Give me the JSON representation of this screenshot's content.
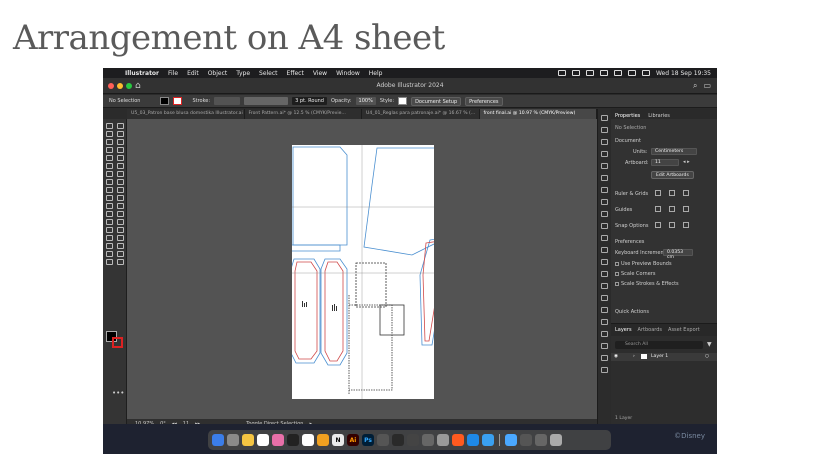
{
  "slide": {
    "title": "Arrangement on A4 sheet"
  },
  "menubar": {
    "app": "Illustrator",
    "items": [
      "File",
      "Edit",
      "Object",
      "Type",
      "Select",
      "Effect",
      "View",
      "Window",
      "Help"
    ],
    "datetime": "Wed 18 Sep  19:35"
  },
  "window": {
    "title": "Adobe Illustrator 2024"
  },
  "control": {
    "selection": "No Selection",
    "stroke_label": "Stroke:",
    "stroke_profile": "3 pt. Round",
    "opacity_label": "Opacity:",
    "opacity_value": "100%",
    "style_label": "Style:",
    "doc_setup": "Document Setup",
    "preferences": "Preferences"
  },
  "tabs": [
    {
      "label": "U5_03_Patron base blusa domestika Illustrator.ai"
    },
    {
      "label": "Front Pattern.ai* @ 12.5 % (CMYK/Previe..."
    },
    {
      "label": "U4_01_Reglas para patronaje.ai* @ 16.67 % (..."
    },
    {
      "label": "front final.ai @ 10.97 % (CMYK/Preview)"
    }
  ],
  "status": {
    "zoom": "10.97%",
    "rotation": "0°",
    "artboard": "11",
    "tool": "Toggle Direct Selection"
  },
  "properties": {
    "tab_properties": "Properties",
    "tab_libraries": "Libraries",
    "no_selection": "No Selection",
    "document": "Document",
    "units_label": "Units:",
    "units_value": "Centimeters",
    "artboard_label": "Artboard:",
    "artboard_value": "11",
    "edit_artboards": "Edit Artboards",
    "rulers_grids": "Ruler & Grids",
    "guides": "Guides",
    "snap_options": "Snap Options",
    "preferences": "Preferences",
    "keyboard_inc_label": "Keyboard Increment:",
    "keyboard_inc_value": "0.0353 cm",
    "use_preview_bounds": "Use Preview Bounds",
    "scale_corners": "Scale Corners",
    "scale_strokes": "Scale Strokes & Effects",
    "quick_actions": "Quick Actions"
  },
  "layers": {
    "tab_layers": "Layers",
    "tab_artboards": "Artboards",
    "tab_asset": "Asset Export",
    "search": "Search All",
    "layer_name": "Layer 1",
    "footer": "1 Layer"
  },
  "dock": {
    "ai_label": "Ai",
    "ps_label": "Ps",
    "notion_label": "N",
    "stamp": "©Disney"
  },
  "colors": {
    "accent": "#3a8ee6",
    "pattern_blue": "#4a8fd0",
    "pattern_red": "#d04a4a"
  }
}
